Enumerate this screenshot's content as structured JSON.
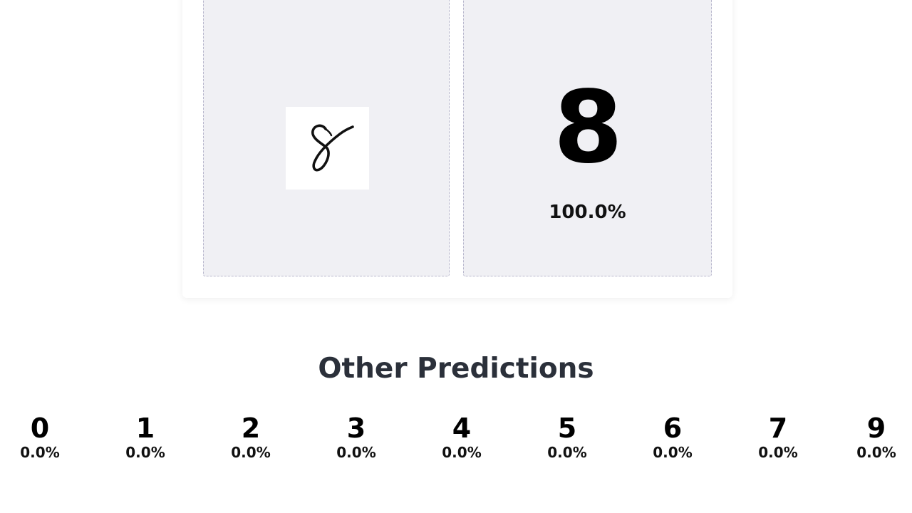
{
  "input": {
    "image_content": "handwritten digit eight"
  },
  "prediction": {
    "digit": "8",
    "confidence": "100.0%"
  },
  "other_predictions": {
    "title": "Other Predictions",
    "items": [
      {
        "label": "0",
        "percent": "0.0%"
      },
      {
        "label": "1",
        "percent": "0.0%"
      },
      {
        "label": "2",
        "percent": "0.0%"
      },
      {
        "label": "3",
        "percent": "0.0%"
      },
      {
        "label": "4",
        "percent": "0.0%"
      },
      {
        "label": "5",
        "percent": "0.0%"
      },
      {
        "label": "6",
        "percent": "0.0%"
      },
      {
        "label": "7",
        "percent": "0.0%"
      },
      {
        "label": "9",
        "percent": "0.0%"
      }
    ]
  }
}
